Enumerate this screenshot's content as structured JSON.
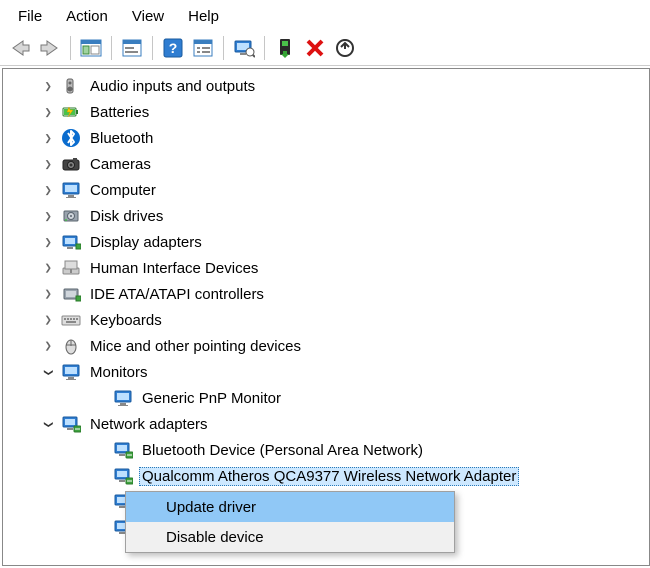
{
  "menubar": {
    "file": "File",
    "action": "Action",
    "view": "View",
    "help": "Help"
  },
  "toolbar_icons": {
    "back": "back-icon",
    "forward": "forward-icon",
    "show_hide": "show-hide-tree-icon",
    "properties": "properties-icon",
    "help": "help-icon",
    "prop_sheet": "property-sheet-icon",
    "scan": "scan-hardware-icon",
    "enable": "enable-device-icon",
    "disable": "disable-device-icon",
    "uninstall": "uninstall-device-icon"
  },
  "tree": [
    {
      "label": "Audio inputs and outputs",
      "state": "collapsed",
      "level": 1,
      "icon": "speaker"
    },
    {
      "label": "Batteries",
      "state": "collapsed",
      "level": 1,
      "icon": "battery"
    },
    {
      "label": "Bluetooth",
      "state": "collapsed",
      "level": 1,
      "icon": "bluetooth"
    },
    {
      "label": "Cameras",
      "state": "collapsed",
      "level": 1,
      "icon": "camera"
    },
    {
      "label": "Computer",
      "state": "collapsed",
      "level": 1,
      "icon": "computer"
    },
    {
      "label": "Disk drives",
      "state": "collapsed",
      "level": 1,
      "icon": "disk"
    },
    {
      "label": "Display adapters",
      "state": "collapsed",
      "level": 1,
      "icon": "display-adapter"
    },
    {
      "label": "Human Interface Devices",
      "state": "collapsed",
      "level": 1,
      "icon": "hid"
    },
    {
      "label": "IDE ATA/ATAPI controllers",
      "state": "collapsed",
      "level": 1,
      "icon": "ide"
    },
    {
      "label": "Keyboards",
      "state": "collapsed",
      "level": 1,
      "icon": "keyboard"
    },
    {
      "label": "Mice and other pointing devices",
      "state": "collapsed",
      "level": 1,
      "icon": "mouse"
    },
    {
      "label": "Monitors",
      "state": "expanded",
      "level": 1,
      "icon": "monitor"
    },
    {
      "label": "Generic PnP Monitor",
      "state": "none",
      "level": 2,
      "icon": "monitor"
    },
    {
      "label": "Network adapters",
      "state": "expanded",
      "level": 1,
      "icon": "network"
    },
    {
      "label": "Bluetooth Device (Personal Area Network)",
      "state": "none",
      "level": 2,
      "icon": "network"
    },
    {
      "label": "Qualcomm Atheros QCA9377 Wireless Network Adapter",
      "state": "none",
      "level": 2,
      "icon": "network",
      "selected": true
    },
    {
      "label": "",
      "state": "none",
      "level": 2,
      "icon": "network"
    },
    {
      "label": "",
      "state": "none",
      "level": 2,
      "icon": "network"
    }
  ],
  "context_menu": {
    "update": "Update driver",
    "disable": "Disable device"
  }
}
